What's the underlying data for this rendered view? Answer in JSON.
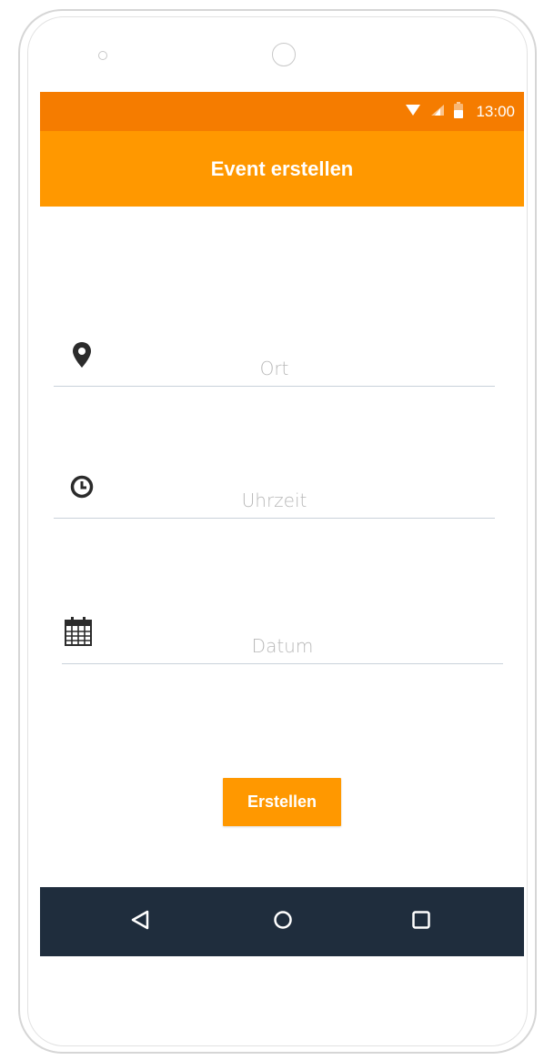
{
  "status_bar": {
    "time": "13:00",
    "icons": [
      "wifi-icon",
      "signal-icon",
      "battery-icon"
    ],
    "color": "#f57c00"
  },
  "app_bar": {
    "title": "Event erstellen",
    "color": "#ff9800"
  },
  "form": {
    "location": {
      "icon": "map-pin-icon",
      "placeholder": "Ort",
      "value": ""
    },
    "time": {
      "icon": "clock-icon",
      "placeholder": "Uhrzeit",
      "value": ""
    },
    "date": {
      "icon": "calendar-icon",
      "placeholder": "Datum",
      "value": ""
    }
  },
  "create_button": {
    "label": "Erstellen"
  },
  "nav_bar": {
    "items": [
      "back-icon",
      "home-icon",
      "recents-icon"
    ],
    "color": "#1f2d3d"
  }
}
